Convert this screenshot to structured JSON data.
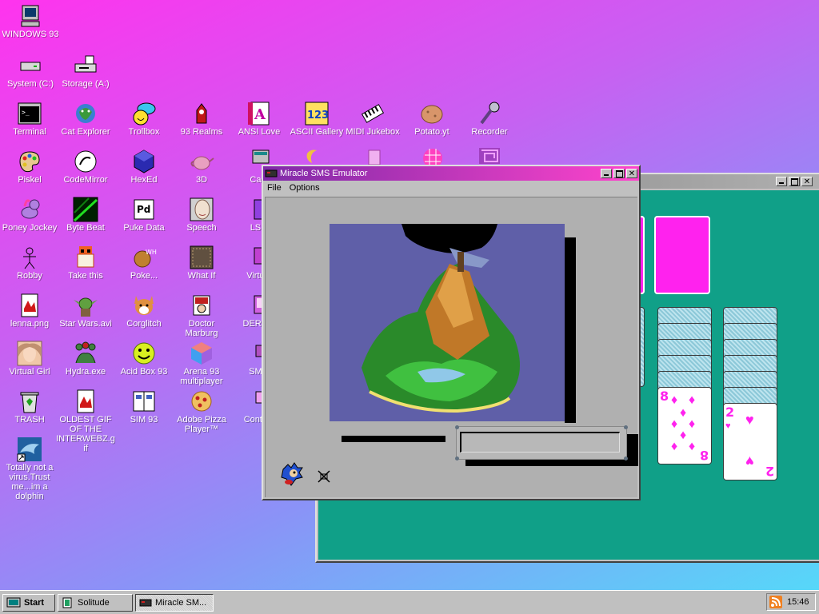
{
  "desktop": {
    "icons": [
      {
        "label": "WINDOWS 93",
        "icon": "computer-icon"
      },
      {
        "label": "System (C:)",
        "icon": "drive-icon"
      },
      {
        "label": "Storage (A:)",
        "icon": "floppy-drive-icon"
      },
      {
        "label": "Terminal",
        "icon": "terminal-icon"
      },
      {
        "label": "Cat Explorer",
        "icon": "cat-explorer-icon"
      },
      {
        "label": "Trollbox",
        "icon": "trollbox-icon"
      },
      {
        "label": "93 Realms",
        "icon": "realms-icon"
      },
      {
        "label": "ANSI Love",
        "icon": "ansi-love-icon"
      },
      {
        "label": "ASCII Gallery",
        "icon": "ascii-gallery-icon"
      },
      {
        "label": "MIDI Jukebox",
        "icon": "midi-jukebox-icon"
      },
      {
        "label": "Potato.yt",
        "icon": "potato-icon"
      },
      {
        "label": "Recorder",
        "icon": "microphone-icon"
      },
      {
        "label": "Piskel",
        "icon": "palette-icon"
      },
      {
        "label": "CodeMirror",
        "icon": "codemirror-icon"
      },
      {
        "label": "HexEd",
        "icon": "hexed-icon"
      },
      {
        "label": "3D",
        "icon": "teapot-icon"
      },
      {
        "label": "Ca...",
        "icon": "calc-icon"
      },
      {
        "label": "Poney Jockey",
        "icon": "pony-icon"
      },
      {
        "label": "Byte Beat",
        "icon": "bytebeat-icon"
      },
      {
        "label": "Puke Data",
        "icon": "puke-data-icon"
      },
      {
        "label": "Speech",
        "icon": "speech-icon"
      },
      {
        "label": "LS...",
        "icon": "lsd-icon"
      },
      {
        "label": "Robby",
        "icon": "robot-icon"
      },
      {
        "label": "Take this",
        "icon": "take-this-icon"
      },
      {
        "label": "Poke...",
        "icon": "pokemon-icon"
      },
      {
        "label": "What If",
        "icon": "what-if-icon"
      },
      {
        "label": "Virtu...",
        "icon": "virtual-icon"
      },
      {
        "label": "lenna.png",
        "icon": "image-file-icon"
      },
      {
        "label": "Star Wars.avi",
        "icon": "yoda-icon"
      },
      {
        "label": "Corglitch",
        "icon": "corgi-icon"
      },
      {
        "label": "Doctor Marburg",
        "icon": "doctor-icon"
      },
      {
        "label": "DERG...",
        "icon": "derg-icon"
      },
      {
        "label": "Virtual Girl",
        "icon": "virtual-girl-icon"
      },
      {
        "label": "Hydra.exe",
        "icon": "hydra-icon"
      },
      {
        "label": "Acid Box 93",
        "icon": "smiley-icon"
      },
      {
        "label": "Arena 93 multiplayer",
        "icon": "cube-icon"
      },
      {
        "label": "SM...",
        "icon": "sm-icon"
      },
      {
        "label": "TRASH",
        "icon": "trash-icon"
      },
      {
        "label": "OLDEST GIF OF THE INTERWEBZ.gif",
        "icon": "gif-file-icon"
      },
      {
        "label": "SIM 93",
        "icon": "sim-icon"
      },
      {
        "label": "Adobe Pizza Player™",
        "icon": "pizza-icon"
      },
      {
        "label": "Conta...",
        "icon": "contact-icon"
      },
      {
        "label": "Totally not a virus.Trust me...im a dolphin",
        "icon": "dolphin-icon"
      }
    ]
  },
  "solitaire_window": {
    "title": "",
    "cards": {
      "eight_rank": "8",
      "two_rank": "2",
      "suit": "♦",
      "heart": "♥"
    }
  },
  "emulator_window": {
    "title": "Miracle SMS Emulator",
    "menu": [
      "File",
      "Options"
    ],
    "status_icons": [
      "sonic-icon",
      "broken-controller-icon"
    ]
  },
  "taskbar": {
    "start_label": "Start",
    "tasks": [
      {
        "label": "Solitude",
        "icon": "solitude-icon"
      },
      {
        "label": "Miracle SM...",
        "icon": "emulator-icon"
      }
    ],
    "clock": "15:46",
    "tray_icon": "rss-icon"
  }
}
